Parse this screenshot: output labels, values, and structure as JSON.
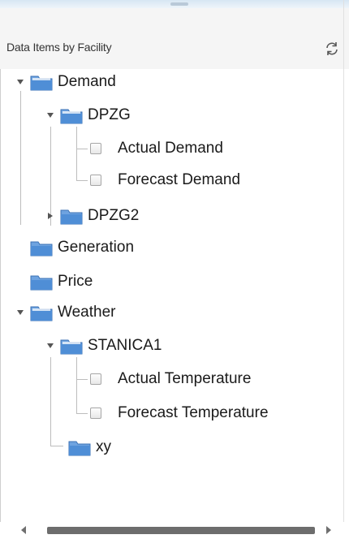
{
  "panel": {
    "title": "Data Items by Facility",
    "refresh_icon": "refresh-icon"
  },
  "tree": {
    "demand": "Demand",
    "dpzg": "DPZG",
    "actual_demand": "Actual Demand",
    "forecast_demand": "Forecast Demand",
    "dpzg2": "DPZG2",
    "generation": "Generation",
    "price": "Price",
    "weather": "Weather",
    "stanica1": "STANICA1",
    "actual_temperature": "Actual Temperature",
    "forecast_temperature": "Forecast Temperature",
    "xy": "xy"
  },
  "colors": {
    "folder_blue": "#4f8ed6",
    "folder_light": "#a8c8ee",
    "connector": "#bdbdbd"
  }
}
